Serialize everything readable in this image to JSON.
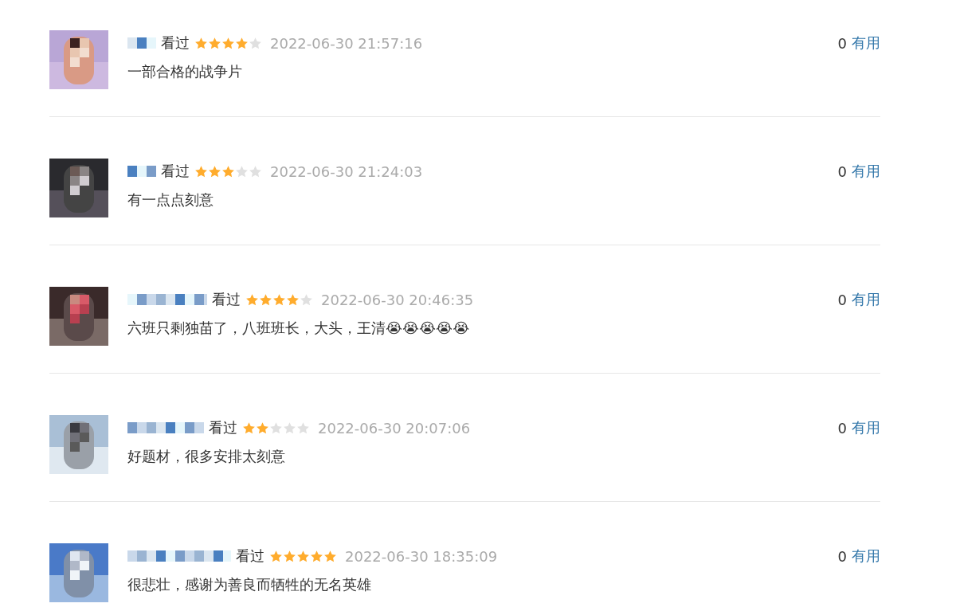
{
  "comments": [
    {
      "status": "看过",
      "stars": 4,
      "time": "2022-06-30 21:57:16",
      "text": "一部合格的战争片",
      "votes": "0",
      "useful": "有用"
    },
    {
      "status": "看过",
      "stars": 3,
      "time": "2022-06-30 21:24:03",
      "text": "有一点点刻意",
      "votes": "0",
      "useful": "有用"
    },
    {
      "status": "看过",
      "stars": 4,
      "time": "2022-06-30 20:46:35",
      "text": "六班只剩独苗了，八班班长，大头，王清😭😭😭😭😭",
      "votes": "0",
      "useful": "有用"
    },
    {
      "status": "看过",
      "stars": 2,
      "time": "2022-06-30 20:07:06",
      "text": "好题材，很多安排太刻意",
      "votes": "0",
      "useful": "有用"
    },
    {
      "status": "看过",
      "stars": 5,
      "time": "2022-06-30 18:35:09",
      "text": "很悲壮，感谢为善良而牺牲的无名英雄",
      "votes": "0",
      "useful": "有用"
    }
  ]
}
